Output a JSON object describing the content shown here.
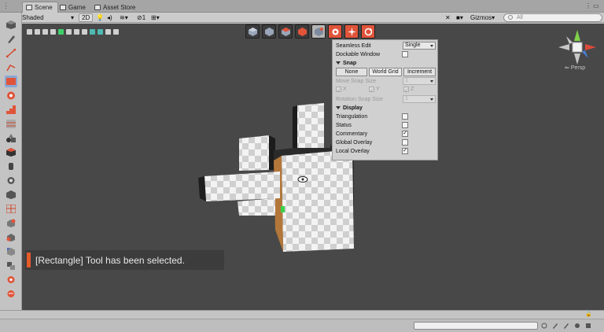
{
  "tabs": [
    {
      "label": "Scene",
      "icon": "hash-icon",
      "active": true
    },
    {
      "label": "Game",
      "icon": "gamepad-icon",
      "active": false
    },
    {
      "label": "Asset Store",
      "icon": "bag-icon",
      "active": false
    }
  ],
  "toolbar": {
    "draw_mode": "Shaded",
    "mode_2d": "2D",
    "layers_count": "1",
    "gizmos_label": "Gizmos",
    "search_placeholder": "All"
  },
  "panel": {
    "seamless_edit_label": "Seamless Edit",
    "seamless_edit_value": "Single",
    "dockable_window_label": "Dockable Window",
    "snap_header": "Snap",
    "snap_buttons": [
      "None",
      "World Grid",
      "Increment"
    ],
    "move_snap_size_label": "Move Snap Size",
    "move_snap_size_value": "1",
    "axes": [
      "X",
      "Y",
      "Z"
    ],
    "rotation_snap_size_label": "Rotation Snap Size",
    "rotation_snap_size_value": "1",
    "display_header": "Display",
    "display_items": [
      {
        "label": "Triangulation",
        "checked": false
      },
      {
        "label": "Status",
        "checked": false
      },
      {
        "label": "Commentary",
        "checked": true
      },
      {
        "label": "Global Overlay",
        "checked": false
      },
      {
        "label": "Local Overlay",
        "checked": true
      }
    ]
  },
  "gizmo": {
    "persp_label": "Persp"
  },
  "notification": {
    "text": "[Rectangle] Tool has been selected.",
    "accent": "#e45b2a"
  }
}
